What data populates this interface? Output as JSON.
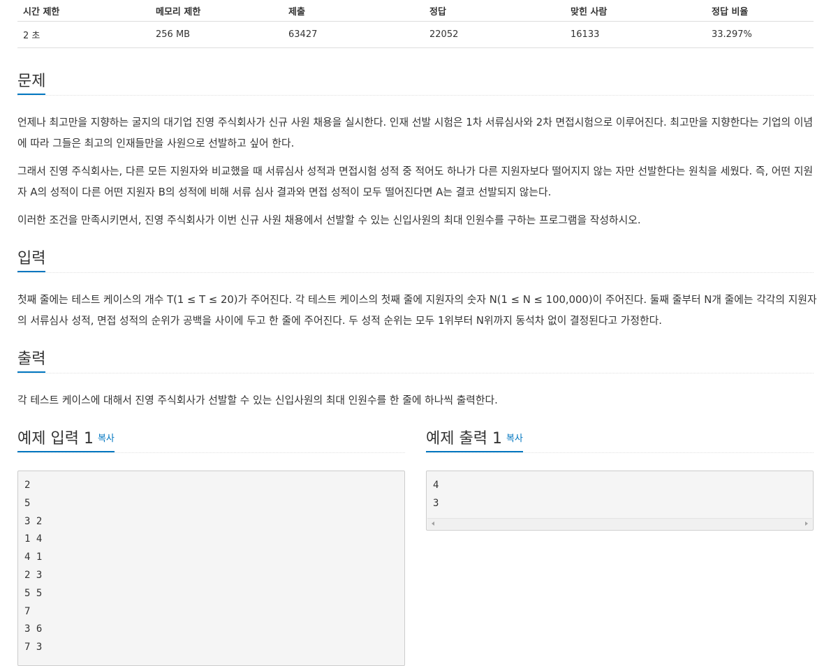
{
  "info": {
    "headers": [
      "시간 제한",
      "메모리 제한",
      "제출",
      "정답",
      "맞힌 사람",
      "정답 비율"
    ],
    "values": [
      "2 초",
      "256 MB",
      "63427",
      "22052",
      "16133",
      "33.297%"
    ]
  },
  "problem": {
    "title": "문제",
    "paragraphs": [
      "언제나 최고만을 지향하는 굴지의 대기업 진영 주식회사가 신규 사원 채용을 실시한다. 인재 선발 시험은 1차 서류심사와 2차 면접시험으로 이루어진다. 최고만을 지향한다는 기업의 이념에 따라 그들은 최고의 인재들만을 사원으로 선발하고 싶어 한다.",
      "그래서 진영 주식회사는, 다른 모든 지원자와 비교했을 때 서류심사 성적과 면접시험 성적 중 적어도 하나가 다른 지원자보다 떨어지지 않는 자만 선발한다는 원칙을 세웠다. 즉, 어떤 지원자 A의 성적이 다른 어떤 지원자 B의 성적에 비해 서류 심사 결과와 면접 성적이 모두 떨어진다면 A는 결코 선발되지 않는다.",
      "이러한 조건을 만족시키면서, 진영 주식회사가 이번 신규 사원 채용에서 선발할 수 있는 신입사원의 최대 인원수를 구하는 프로그램을 작성하시오."
    ]
  },
  "input": {
    "title": "입력",
    "text": "첫째 줄에는 테스트 케이스의 개수 T(1 ≤ T ≤ 20)가 주어진다. 각 테스트 케이스의 첫째 줄에 지원자의 숫자 N(1 ≤ N ≤ 100,000)이 주어진다. 둘째 줄부터 N개 줄에는 각각의 지원자의 서류심사 성적, 면접 성적의 순위가 공백을 사이에 두고 한 줄에 주어진다. 두 성적 순위는 모두 1위부터 N위까지 동석차 없이 결정된다고 가정한다."
  },
  "output": {
    "title": "출력",
    "text": "각 테스트 케이스에 대해서 진영 주식회사가 선발할 수 있는 신입사원의 최대 인원수를 한 줄에 하나씩 출력한다."
  },
  "sample_input": {
    "title": "예제 입력 1",
    "copy_label": "복사",
    "lines": [
      "2",
      "5",
      "3 2",
      "1 4",
      "4 1",
      "2 3",
      "5 5",
      "7",
      "3 6",
      "7 3"
    ]
  },
  "sample_output": {
    "title": "예제 출력 1",
    "copy_label": "복사",
    "lines": [
      "4",
      "3"
    ]
  },
  "colors": {
    "accent": "#0076c0",
    "sample_bg": "#f5f5f5",
    "border": "#dddddd"
  }
}
